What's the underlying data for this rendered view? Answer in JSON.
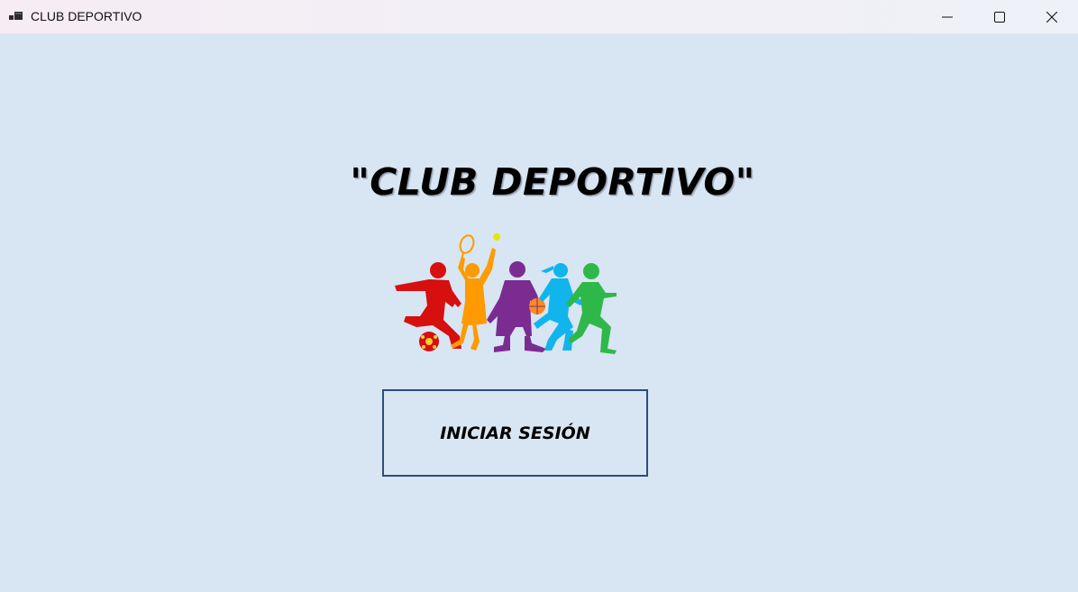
{
  "window": {
    "title": "CLUB DEPORTIVO",
    "icon": "app-window-icon",
    "background": "#d8e5f2",
    "controls": {
      "minimize_icon": "minimize-icon",
      "maximize_icon": "maximize-icon",
      "close_icon": "close-icon"
    }
  },
  "main": {
    "heading": "\"CLUB DEPORTIVO\"",
    "logo_icon": "sports-kids-silhouettes-logo",
    "logo_colors": [
      "#d60f0f",
      "#ff9a00",
      "#7b2c91",
      "#12b4ec",
      "#2fb84a"
    ],
    "login_button_label": "INICIAR SESIÓN",
    "login_button_border": "#2e4d7c"
  }
}
